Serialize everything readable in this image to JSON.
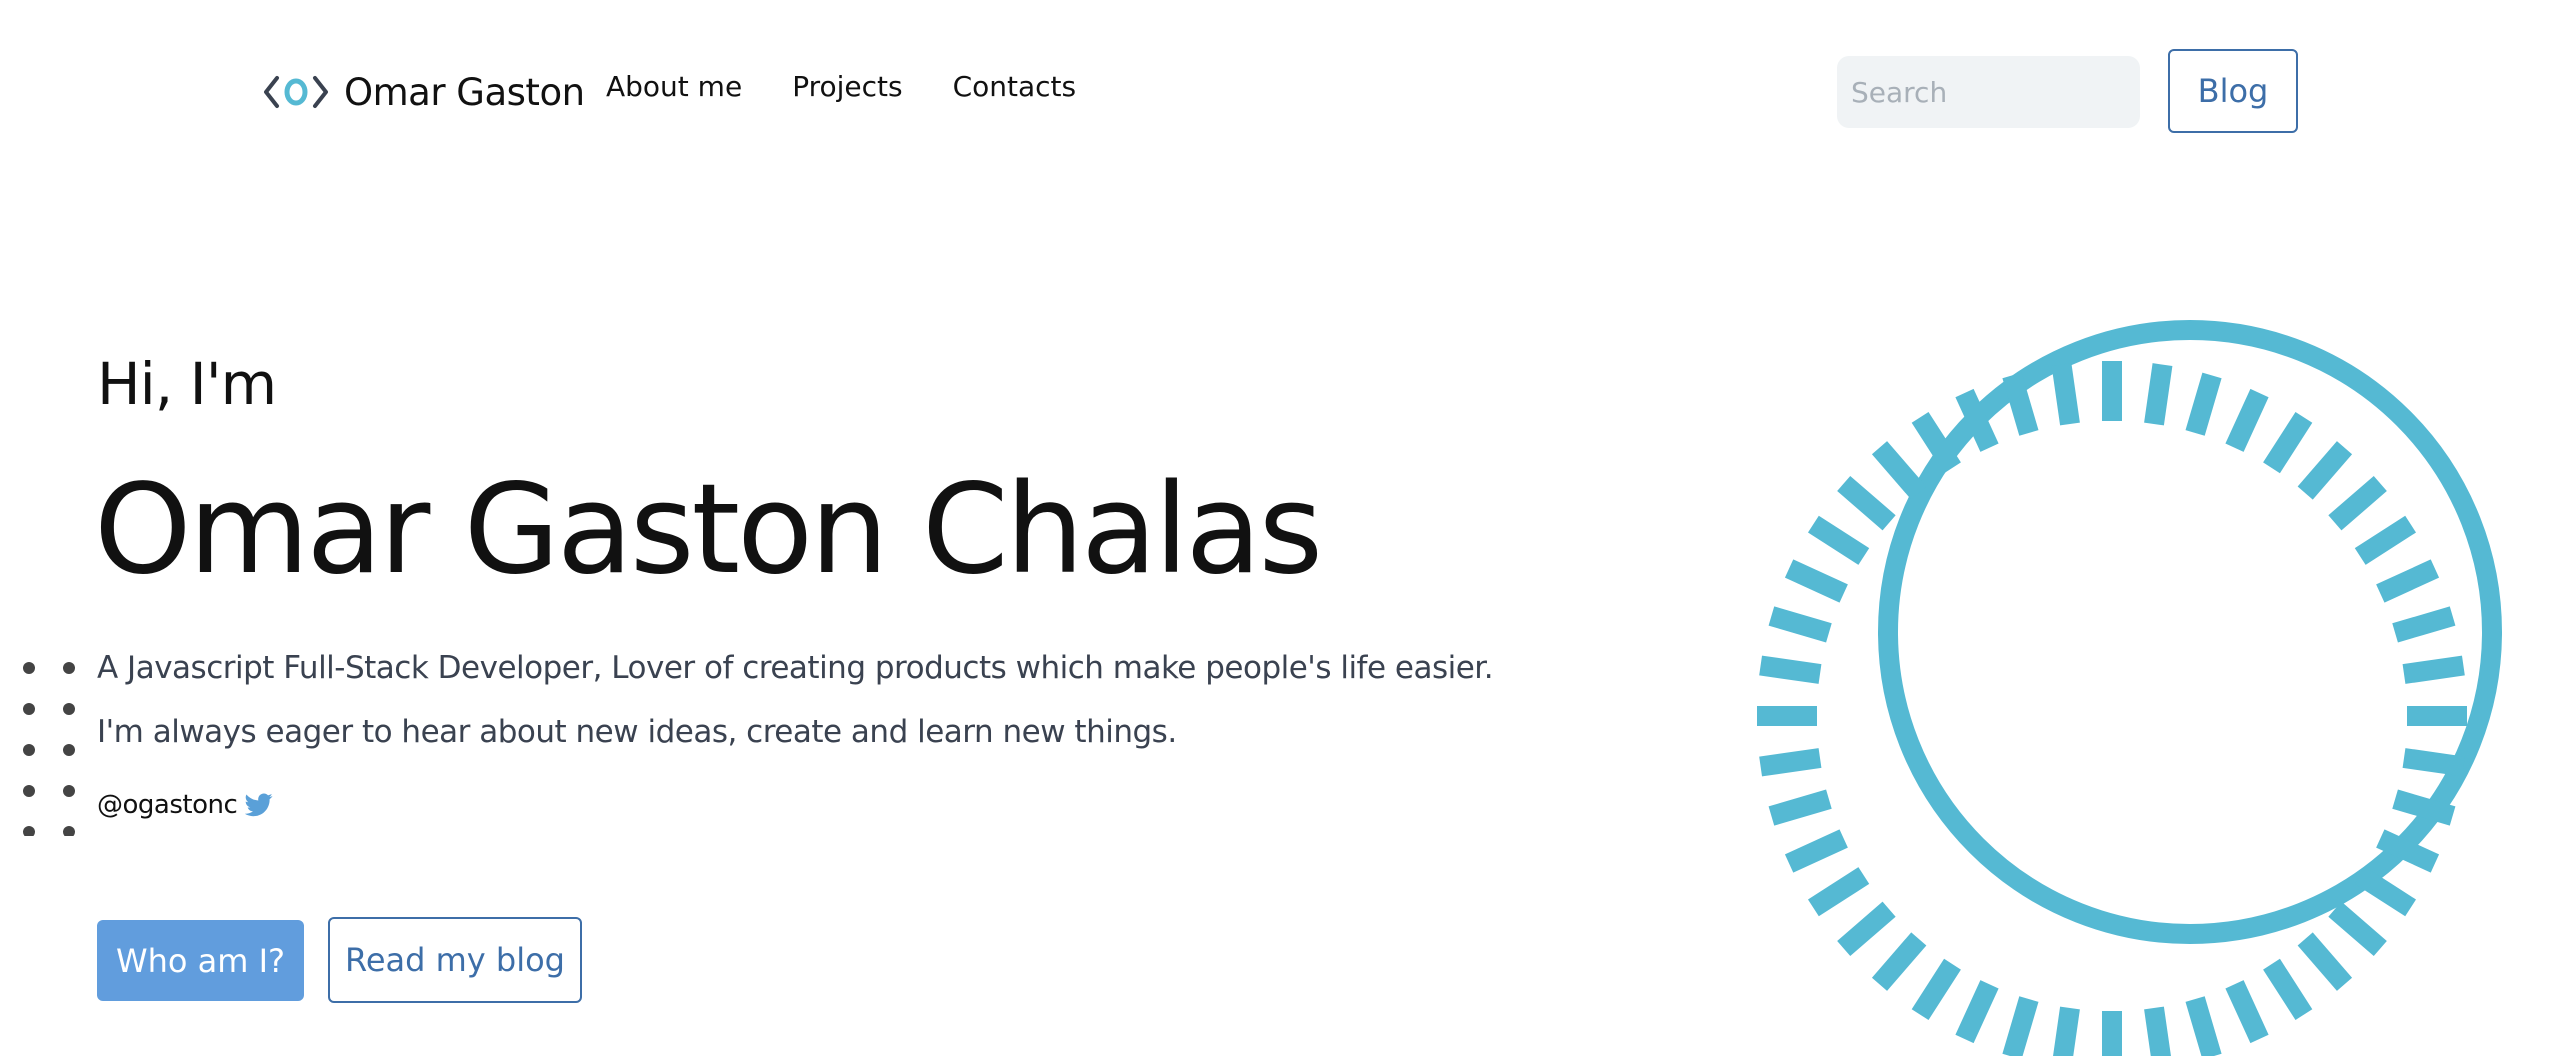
{
  "colors": {
    "accent_teal": "#55b9d3",
    "primary_blue": "#619ddd",
    "outline_blue": "#3d6ea8",
    "text_dark": "#111111",
    "text_muted": "#3a4250",
    "search_bg": "#f0f3f5",
    "twitter_blue": "#5aa0d8"
  },
  "nav": {
    "brand_logo_icon": "code-brackets-icon",
    "brand_name": "Omar Gaston",
    "links": [
      {
        "label": "About me"
      },
      {
        "label": "Projects"
      },
      {
        "label": "Contacts"
      }
    ],
    "search_placeholder": "Search",
    "search_value": "",
    "blog_label": "Blog"
  },
  "hero": {
    "greeting": "Hi, I'm",
    "name": "Omar Gaston Chalas",
    "tagline_1": "A Javascript Full-Stack Developer, Lover of creating products which make people's life easier.",
    "tagline_2": "I'm always eager to hear about new ideas, create and learn new things.",
    "handle": "@ogastonc",
    "handle_icon": "twitter-icon",
    "primary_button": "Who am I?",
    "secondary_button": "Read my blog"
  },
  "decorations": {
    "left": "dot-grid",
    "right": "concentric-circle-with-dashed-ring"
  }
}
